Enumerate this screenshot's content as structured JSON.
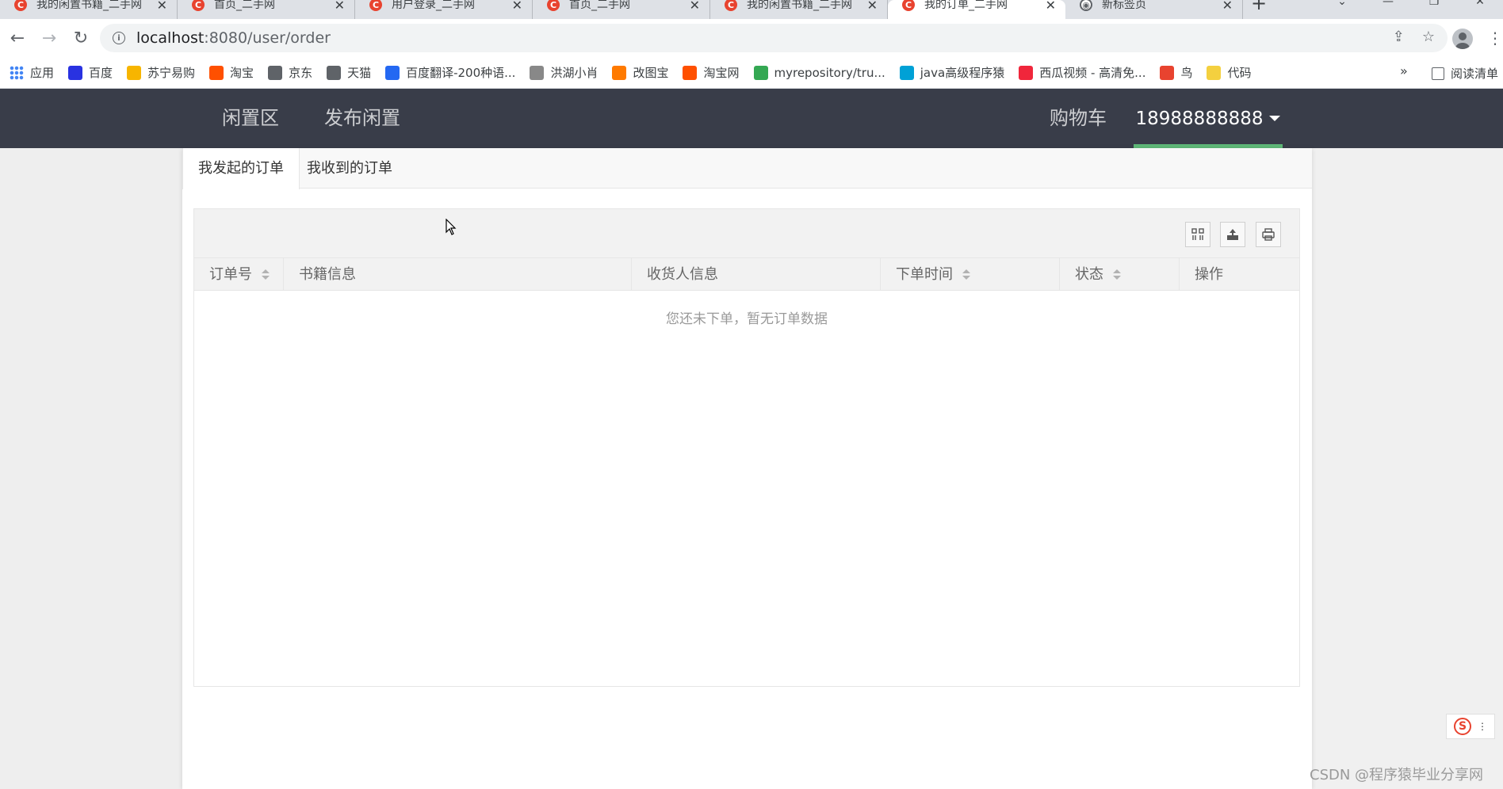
{
  "browser": {
    "tabs": [
      {
        "title": "我的闲置书籍_二手网",
        "icon": "c-logo-icon"
      },
      {
        "title": "首页_二手网",
        "icon": "c-logo-icon"
      },
      {
        "title": "用户登录_二手网",
        "icon": "c-logo-icon"
      },
      {
        "title": "首页_二手网",
        "icon": "c-logo-icon"
      },
      {
        "title": "我的闲置书籍_二手网",
        "icon": "c-logo-icon"
      },
      {
        "title": "我的订单_二手网",
        "icon": "c-logo-icon",
        "active": true
      },
      {
        "title": "新标签页",
        "icon": "globe-icon"
      }
    ],
    "url_host": "localhost",
    "url_path": ":8080/user/order",
    "bookmarks": [
      {
        "label": "应用",
        "color": "#4285f4"
      },
      {
        "label": "百度",
        "color": "#2932e1"
      },
      {
        "label": "苏宁易购",
        "color": "#f7b500"
      },
      {
        "label": "淘宝",
        "color": "#ff5000"
      },
      {
        "label": "京东",
        "color": "#5f6368"
      },
      {
        "label": "天猫",
        "color": "#5f6368"
      },
      {
        "label": "百度翻译-200种语...",
        "color": "#2468f2"
      },
      {
        "label": "洪湖小肖",
        "color": "#888888"
      },
      {
        "label": "改图宝",
        "color": "#ff7a00"
      },
      {
        "label": "淘宝网",
        "color": "#ff5000"
      },
      {
        "label": "myrepository/tru...",
        "color": "#34a853"
      },
      {
        "label": "java高级程序猿",
        "color": "#00a1d6"
      },
      {
        "label": "西瓜视频 - 高清免...",
        "color": "#f0263b"
      },
      {
        "label": "鸟",
        "color": "#e8432f"
      },
      {
        "label": "代码",
        "color": "#f4d03f"
      }
    ],
    "more_label": "»",
    "reading_list_label": "阅读清单"
  },
  "header": {
    "nav": [
      "闲置区",
      "发布闲置"
    ],
    "cart_label": "购物车",
    "user_phone": "18988888888",
    "accent_color": "#5fb878",
    "bg_color": "#393d49"
  },
  "order_tabs": [
    "我发起的订单",
    "我收到的订单"
  ],
  "table": {
    "columns": [
      {
        "label": "订单号",
        "sortable": true
      },
      {
        "label": "书籍信息",
        "sortable": false
      },
      {
        "label": "收货人信息",
        "sortable": false
      },
      {
        "label": "下单时间",
        "sortable": true
      },
      {
        "label": "状态",
        "sortable": true
      },
      {
        "label": "操作",
        "sortable": false
      }
    ],
    "empty_text": "您还未下单，暂无订单数据",
    "toolbar_icons": [
      "columns-icon",
      "export-icon",
      "print-icon"
    ]
  },
  "widget_label": "S",
  "watermark": "CSDN @程序猿毕业分享网"
}
